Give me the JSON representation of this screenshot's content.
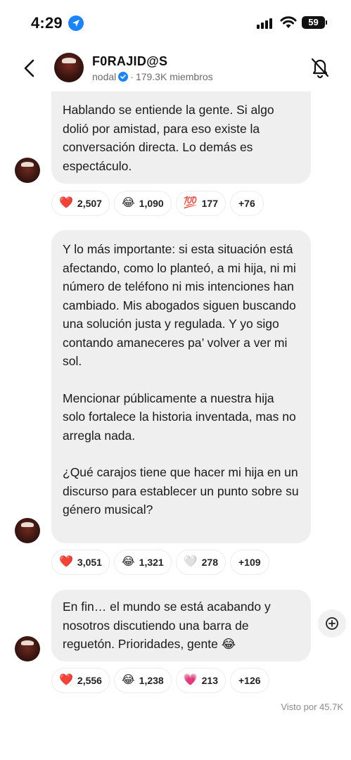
{
  "status_bar": {
    "time": "4:29",
    "battery": "59"
  },
  "header": {
    "title": "F0RAJID@S",
    "owner": "nodal",
    "members": "179.3K miembros"
  },
  "messages": [
    {
      "paragraphs": [
        "Hablando se entiende la gente. Si algo dolió por amistad, para eso existe la conversación directa. Lo demás es espectáculo."
      ],
      "reactions": [
        {
          "emoji": "❤️",
          "icon": "red-heart-icon",
          "count": "2,507"
        },
        {
          "emoji": "😂",
          "icon": "laughing-icon",
          "count": "1,090"
        },
        {
          "emoji": "💯",
          "icon": "hundred-icon",
          "count": "177"
        }
      ],
      "more": "+76"
    },
    {
      "paragraphs": [
        "Y lo más importante: si esta situación está afectando, como lo planteó, a mi hija, ni mi número de teléfono ni mis intenciones han cambiado. Mis abogados siguen buscando una solución justa y regulada. Y yo sigo contando amaneceres pa’ volver a ver mi sol.",
        "Mencionar públicamente a nuestra hija solo fortalece la historia inventada, mas no arregla nada.",
        "¿Qué carajos tiene que hacer mi hija en un discurso para establecer un punto sobre su género musical?"
      ],
      "reactions": [
        {
          "emoji": "❤️",
          "icon": "red-heart-icon",
          "count": "3,051"
        },
        {
          "emoji": "😂",
          "icon": "laughing-icon",
          "count": "1,321"
        },
        {
          "emoji": "🤍",
          "icon": "white-heart-icon",
          "count": "278"
        }
      ],
      "more": "+109"
    },
    {
      "paragraphs": [
        "En fin… el mundo se está acabando y nosotros discutiendo una barra de reguetón. Prioridades, gente 😂"
      ],
      "reactions": [
        {
          "emoji": "❤️",
          "icon": "red-heart-icon",
          "count": "2,556"
        },
        {
          "emoji": "😂",
          "icon": "laughing-icon",
          "count": "1,238"
        },
        {
          "emoji": "💗",
          "icon": "pink-heart-icon",
          "count": "213"
        }
      ],
      "more": "+126"
    }
  ],
  "seen_by": "Visto por 45.7K"
}
